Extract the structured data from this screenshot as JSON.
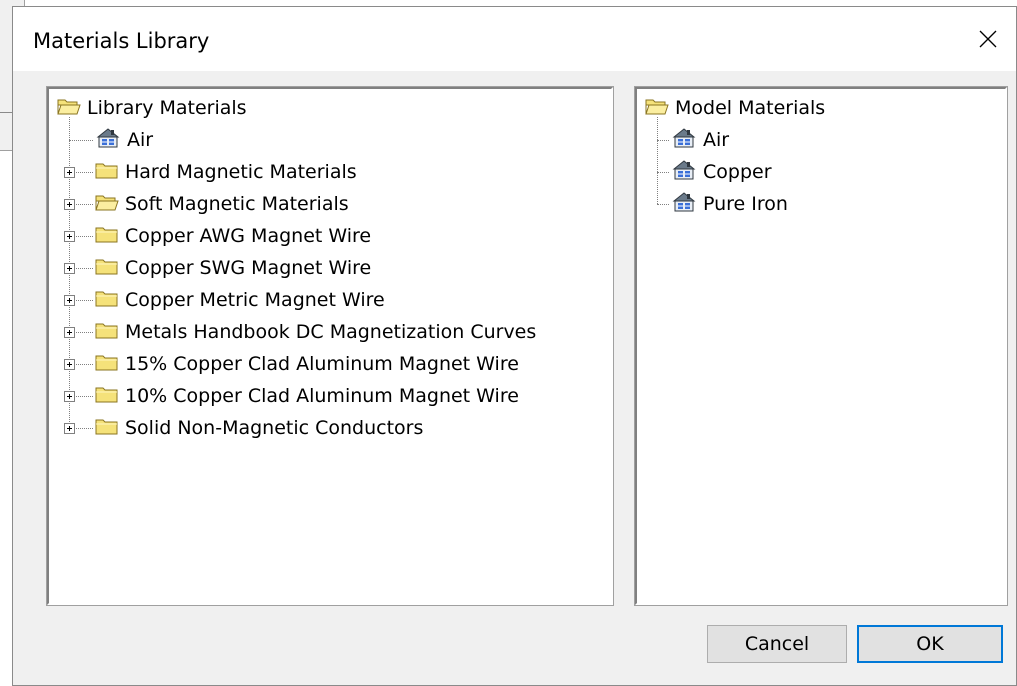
{
  "dialog": {
    "title": "Materials Library",
    "close_glyph": "×"
  },
  "library": {
    "root_label": "Library Materials",
    "items": [
      {
        "label": "Air",
        "icon": "material-icon",
        "expandable": false
      },
      {
        "label": "Hard Magnetic Materials",
        "icon": "folder-icon",
        "expandable": true
      },
      {
        "label": "Soft Magnetic Materials",
        "icon": "open-folder-icon",
        "expandable": true
      },
      {
        "label": "Copper AWG Magnet Wire",
        "icon": "folder-icon",
        "expandable": true
      },
      {
        "label": "Copper SWG Magnet Wire",
        "icon": "folder-icon",
        "expandable": true
      },
      {
        "label": "Copper Metric Magnet Wire",
        "icon": "folder-icon",
        "expandable": true
      },
      {
        "label": "Metals Handbook DC Magnetization Curves",
        "icon": "folder-icon",
        "expandable": true
      },
      {
        "label": "15% Copper Clad Aluminum Magnet Wire",
        "icon": "folder-icon",
        "expandable": true
      },
      {
        "label": "10% Copper Clad Aluminum Magnet Wire",
        "icon": "folder-icon",
        "expandable": true
      },
      {
        "label": "Solid Non-Magnetic Conductors",
        "icon": "folder-icon",
        "expandable": true
      }
    ]
  },
  "model": {
    "root_label": "Model Materials",
    "items": [
      {
        "label": "Air",
        "icon": "material-icon"
      },
      {
        "label": "Copper",
        "icon": "material-icon"
      },
      {
        "label": "Pure Iron",
        "icon": "material-icon"
      }
    ]
  },
  "buttons": {
    "cancel": "Cancel",
    "ok": "OK"
  },
  "colors": {
    "folder_fill": "#f5e27a",
    "folder_edge": "#8a7420",
    "accent": "#0078d7"
  }
}
